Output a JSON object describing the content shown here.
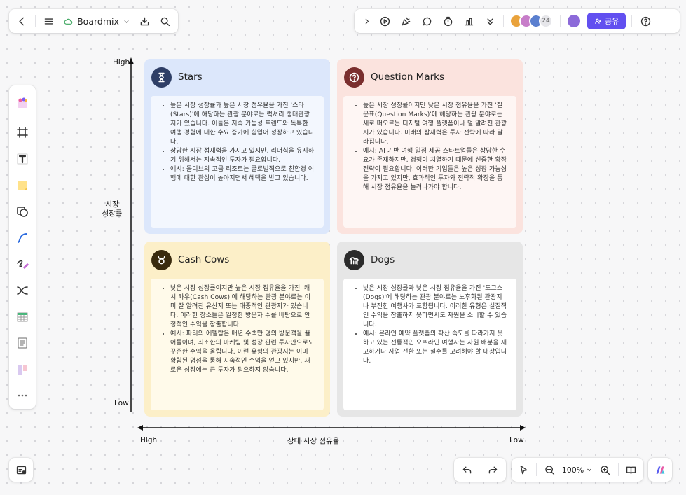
{
  "toolbar_left": {
    "board_name": "Boardmix",
    "icons": [
      "back-icon",
      "menu-icon",
      "cloud-icon",
      "chevron-down-icon",
      "download-icon",
      "search-icon"
    ]
  },
  "toolbar_right": {
    "icons": [
      "chevron-right-icon",
      "play-icon",
      "celebrate-icon",
      "comment-icon",
      "timer-icon",
      "vote-icon",
      "chevron-double-down-icon"
    ],
    "avatar_count": "24",
    "share_label": "공유",
    "help_icon": "help-icon"
  },
  "left_tools": [
    "template-icon",
    "frame-icon",
    "text-icon",
    "sticky-note-icon",
    "shape-icon",
    "pen-icon",
    "highlighter-icon",
    "connector-icon",
    "table-icon",
    "document-icon",
    "kanban-icon",
    "more-icon"
  ],
  "axes": {
    "y_high": "High",
    "y_low": "Low",
    "y_title_line1": "시장",
    "y_title_line2": "성장률",
    "x_high": "High",
    "x_low": "Low",
    "x_title": "상대 시장 점유율"
  },
  "quadrants": {
    "stars": {
      "title": "Stars",
      "icon": "hourglass-icon",
      "colors": {
        "bg": "#dce7fb",
        "body": "#f3f7fe",
        "icon": "#2e3e66"
      },
      "bullets": [
        "높은 시장 성장률과 높은 시장 점유율을 가진 '스타(Stars)'에 해당하는 관광 분야로는 럭셔리 생태관광지가 있습니다. 이들은 지속 가능성 트렌드와 독특한 여행 경험에 대한 수요 증가에 힘입어 성장하고 있습니다.",
        "상당한 시장 점재력을 가지고 있지만, 리더십을 유지하기 위해서는 지속적인 투자가 필요합니다.",
        "예시: 몰디브의 고급 리조트는 글로벌적으로 친환경 여행에 대한 관심이 높아지면서 혜택을 받고 있습니다."
      ]
    },
    "question": {
      "title": "Question Marks",
      "icon": "question-icon",
      "colors": {
        "bg": "#fbe3de",
        "body": "#fef6f4",
        "icon": "#7a2e2e"
      },
      "bullets": [
        "높은 시장 성장률이지만 낮은 시장 점유율을 가진 '질문표(Question Marks)'에 해당하는 관광 분야로는 새로 떠오르는 디지털 여행 플랫폼이나 덜 알려진 관광지가 있습니다. 미래의 잠재력은 투자 전략에 따라 달라집니다.",
        "예시: AI 기반 여행 일정 제공 스타트업들은 상당한 수요가 존재하지만, 경쟁이 치열하기 때문에 신중한 확장 전략이 필요합니다. 이러한 기업들은 높은 성장 가능성을 가지고 있지만, 효과적인 투자와 전략적 확장을 통해 시장 점유율을 늘려나가야 합니다."
      ]
    },
    "cash": {
      "title": "Cash Cows",
      "icon": "bull-icon",
      "colors": {
        "bg": "#fcefc8",
        "body": "#fffaea",
        "icon": "#3a2b0e"
      },
      "bullets": [
        "낮은 시장 성장률이지만 높은 시장 점유율을 가진 '캐시 카우(Cash Cows)'에 해당하는 관광 분야로는 이미 잘 알려진 유산지 또는 대중적인 관광지가 있습니다. 이러한 장소들은 일정한 방문자 수를 바탕으로 안정적인 수익을 창출합니다.",
        "예시: 파리의 에펠탑은 매년 수백만 명의 방문객을 끌어들이며, 최소한의 마케팅 및 성장 관련 투자만으로도 꾸준한 수익을 올립니다. 이런 유형의 관광지는 이미 확립된 명성을 통해 지속적인 수익을 얻고 있지만, 새로운 성장에는 큰 투자가 필요하지 않습니다."
      ]
    },
    "dogs": {
      "title": "Dogs",
      "icon": "dog-icon",
      "colors": {
        "bg": "#e6e6e6",
        "body": "#ffffff",
        "icon": "#2b2b2b"
      },
      "bullets": [
        "낮은 시장 성장률과 낮은 시장 점유율을 가진 '도그스(Dogs)'에 해당하는 관광 분야로는 노후화된 관광지나 부진한 여행사가 포함됩니다. 이러한 유형은 실질적인 수익을 창출하지 못하면서도 자원을 소비할 수 있습니다.",
        "예시: 온라인 예약 플랫폼의 확산 속도를 따라가지 못하고 있는 전통적인 오프라인 여행사는 자원 배분을 재고하거나 사업 전환 또는 철수를 고려해야 할 대상입니다."
      ]
    }
  },
  "bottom": {
    "zoom": "100%",
    "icons": [
      "minimap-icon",
      "undo-icon",
      "redo-icon",
      "select-icon",
      "zoom-out-icon",
      "zoom-in-icon",
      "book-icon",
      "brand-icon"
    ]
  }
}
